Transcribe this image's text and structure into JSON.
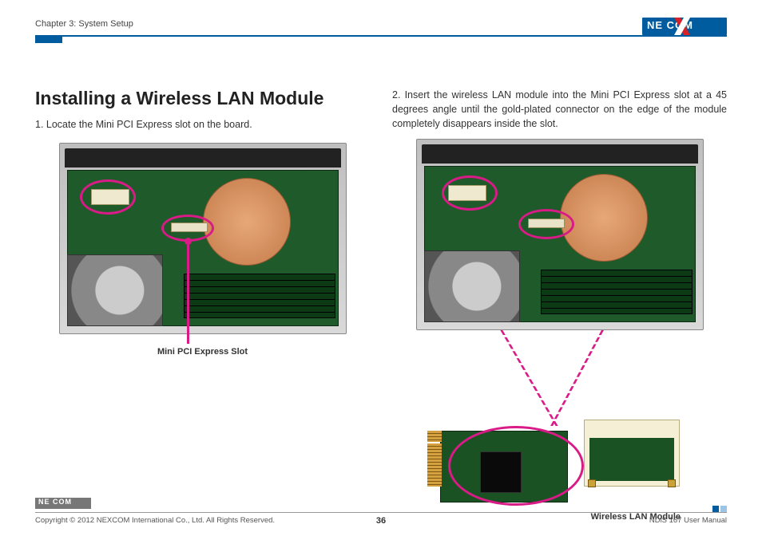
{
  "header": {
    "chapter": "Chapter 3: System Setup",
    "logo_text": "NE  COM"
  },
  "title": "Installing a Wireless LAN Module",
  "step1": "1.  Locate the Mini PCI Express slot on the board.",
  "step2": "2.  Insert the wireless LAN module into the Mini PCI Express slot at a 45 degrees angle until the gold-plated connector on the edge of the module completely disappears inside the slot.",
  "caption_left": "Mini PCI Express Slot",
  "caption_right": "Wireless LAN Module",
  "footer": {
    "copyright": "Copyright © 2012 NEXCOM International Co., Ltd. All Rights Reserved.",
    "page": "36",
    "doc": "NDiS 167 User Manual",
    "logo_text": "NE  COM"
  }
}
